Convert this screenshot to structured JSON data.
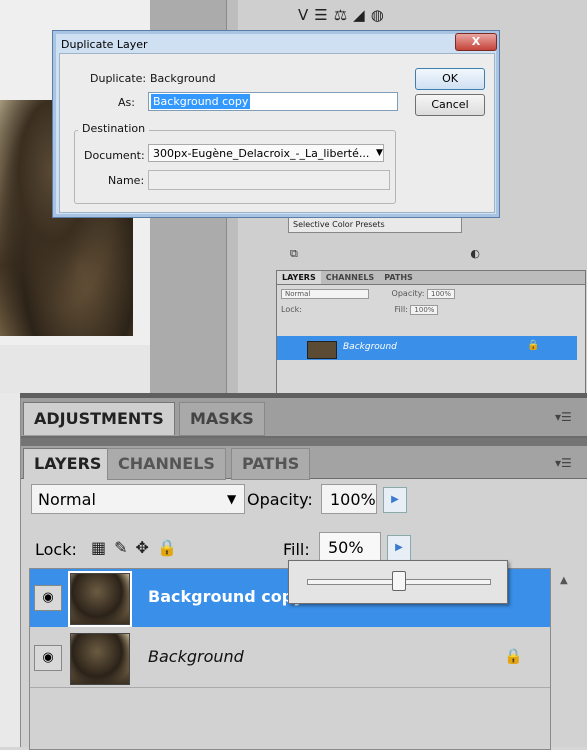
{
  "dialog": {
    "title": "Duplicate Layer",
    "close_label": "X",
    "duplicate_label": "Duplicate:",
    "duplicate_value": "Background",
    "as_label": "As:",
    "as_value": "Background copy",
    "ok_label": "OK",
    "cancel_label": "Cancel",
    "destination_legend": "Destination",
    "document_label": "Document:",
    "document_value": "300px-Eugène_Delacroix_-_La_liberté...",
    "name_label": "Name:",
    "name_value": ""
  },
  "small_panel": {
    "selective_color_presets": "Selective Color Presets",
    "tabs": [
      "LAYERS",
      "CHANNELS",
      "PATHS"
    ],
    "blend_mode": "Normal",
    "opacity_label": "Opacity:",
    "opacity_value": "100%",
    "lock_label": "Lock:",
    "fill_label": "Fill:",
    "fill_value": "100%",
    "layer_name": "Background"
  },
  "panel": {
    "top_tabs": [
      "ADJUSTMENTS",
      "MASKS"
    ],
    "layer_tabs": [
      "LAYERS",
      "CHANNELS",
      "PATHS"
    ],
    "blend_mode": "Normal",
    "opacity_label": "Opacity:",
    "opacity_value": "100%",
    "lock_label": "Lock:",
    "fill_label": "Fill:",
    "fill_value": "50%",
    "fill_slider_fraction": 0.5,
    "layers": [
      {
        "name": "Background copy",
        "selected": true,
        "locked": false
      },
      {
        "name": "Background",
        "selected": false,
        "locked": true
      }
    ]
  },
  "icons": {
    "eye": "eye-icon",
    "lock": "lock-icon",
    "menu": "panel-menu-icon",
    "flyout": "flyout-arrow-icon"
  },
  "colors": {
    "selection_blue": "#3a8fe8",
    "dialog_frame": "#cfe0f2",
    "close_red": "#c5443a"
  }
}
